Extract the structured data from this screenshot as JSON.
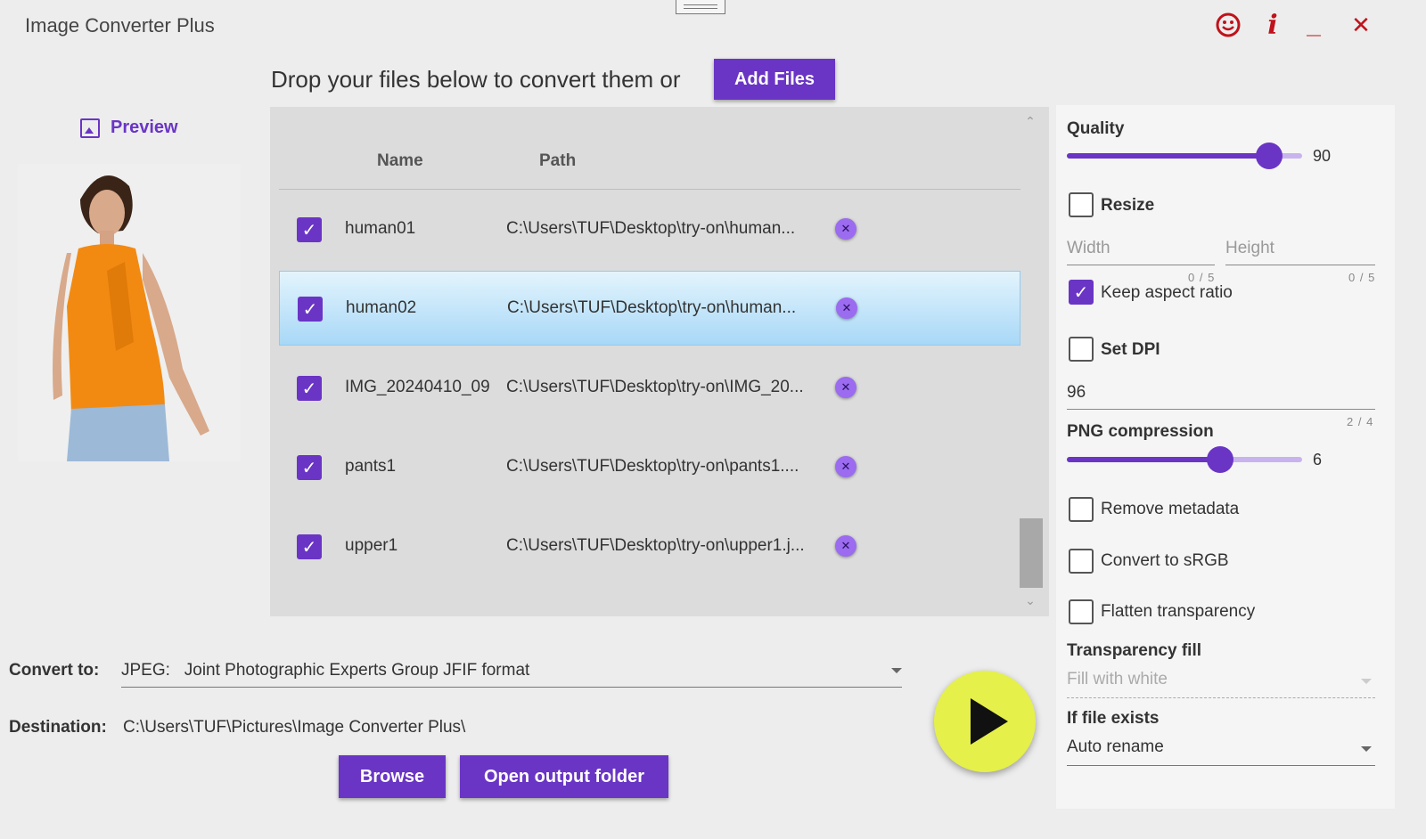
{
  "app": {
    "title": "Image Converter Plus"
  },
  "header": {
    "drop_text": "Drop your files below to convert them or",
    "add_files_label": "Add Files"
  },
  "preview": {
    "label": "Preview"
  },
  "files": {
    "columns": {
      "name": "Name",
      "path": "Path"
    },
    "rows": [
      {
        "name": "human01",
        "path": "C:\\Users\\TUF\\Desktop\\try-on\\human...",
        "checked": true
      },
      {
        "name": "human02",
        "path": "C:\\Users\\TUF\\Desktop\\try-on\\human...",
        "checked": true
      },
      {
        "name": "IMG_20240410_09",
        "path": "C:\\Users\\TUF\\Desktop\\try-on\\IMG_20...",
        "checked": true
      },
      {
        "name": "pants1",
        "path": "C:\\Users\\TUF\\Desktop\\try-on\\pants1....",
        "checked": true
      },
      {
        "name": "upper1",
        "path": "C:\\Users\\TUF\\Desktop\\try-on\\upper1.j...",
        "checked": true
      }
    ],
    "selected_index": 1
  },
  "settings": {
    "quality": {
      "label": "Quality",
      "value": "90",
      "fraction": 0.9
    },
    "resize": {
      "label": "Resize",
      "checked": false
    },
    "width": {
      "placeholder": "Width",
      "counter": "0 / 5"
    },
    "height": {
      "placeholder": "Height",
      "counter": "0 / 5"
    },
    "keep_aspect": {
      "label": "Keep aspect ratio",
      "checked": true
    },
    "set_dpi": {
      "label": "Set DPI",
      "checked": false
    },
    "dpi": {
      "value": "96",
      "counter": "2 / 4"
    },
    "png_compression": {
      "label": "PNG compression",
      "value": "6",
      "fraction": 0.66
    },
    "remove_metadata": {
      "label": "Remove metadata",
      "checked": false
    },
    "convert_srgb": {
      "label": "Convert to sRGB",
      "checked": false
    },
    "flatten": {
      "label": "Flatten transparency",
      "checked": false
    },
    "transparency_fill": {
      "label": "Transparency fill",
      "value": "Fill with white"
    },
    "if_file_exists": {
      "label": "If file exists",
      "value": "Auto rename"
    }
  },
  "output": {
    "convert_label": "Convert to:",
    "format_code": "JPEG:",
    "format_name": "Joint Photographic Experts Group JFIF format",
    "destination_label": "Destination:",
    "destination_path": "C:\\Users\\TUF\\Pictures\\Image Converter Plus\\",
    "browse_label": "Browse",
    "open_folder_label": "Open output folder"
  },
  "colors": {
    "accent": "#6a35c5",
    "close_red": "#c0121b",
    "play": "#e5f04a"
  }
}
